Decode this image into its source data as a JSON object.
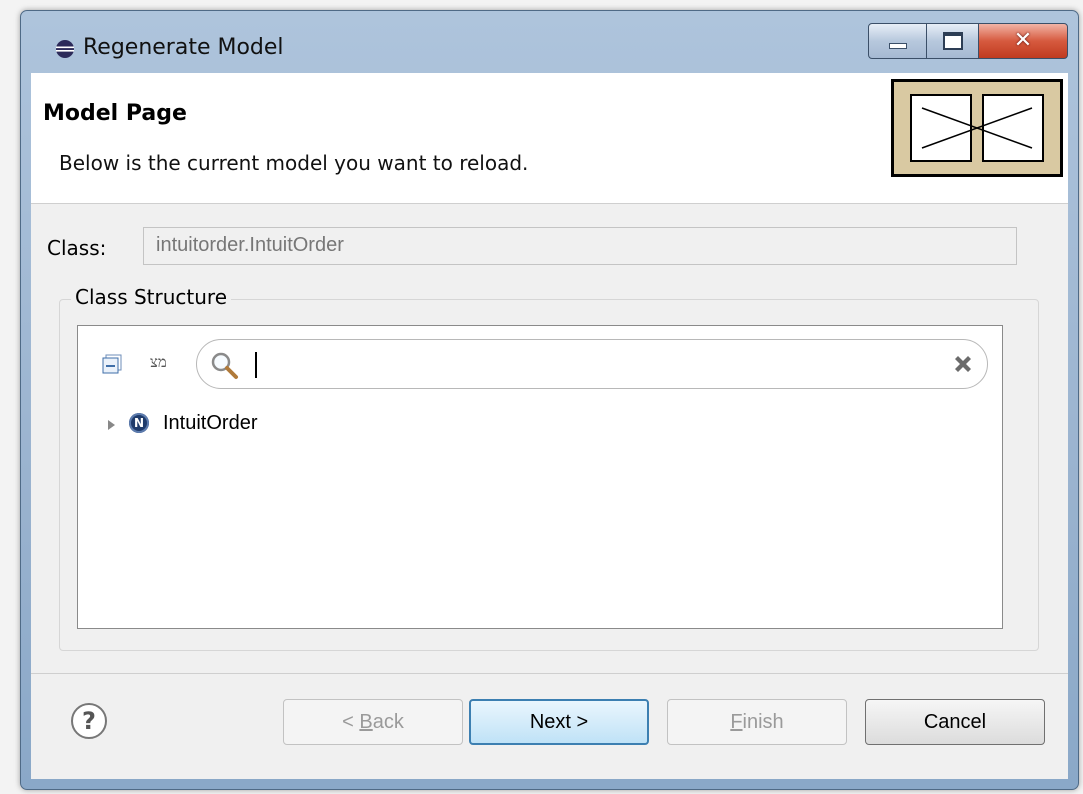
{
  "window": {
    "title": "Regenerate Model",
    "title_icon": "eclipse-icon"
  },
  "header": {
    "title": "Model Page",
    "description": "Below is the current model you want to reload."
  },
  "form": {
    "class_label": "Class:",
    "class_value": "intuitorder.IntuitOrder"
  },
  "structure": {
    "group_label": "Class Structure",
    "filter_glyph": "מצ",
    "search_value": "",
    "tree": [
      {
        "label": "IntuitOrder",
        "icon": "node-icon",
        "badge": "N",
        "expanded": false
      }
    ]
  },
  "buttons": {
    "back": {
      "prefix": "< ",
      "mnemonic": "B",
      "rest": "ack"
    },
    "next": "Next >",
    "finish": {
      "mnemonic": "F",
      "rest": "inish"
    },
    "cancel": "Cancel",
    "help": "?"
  }
}
